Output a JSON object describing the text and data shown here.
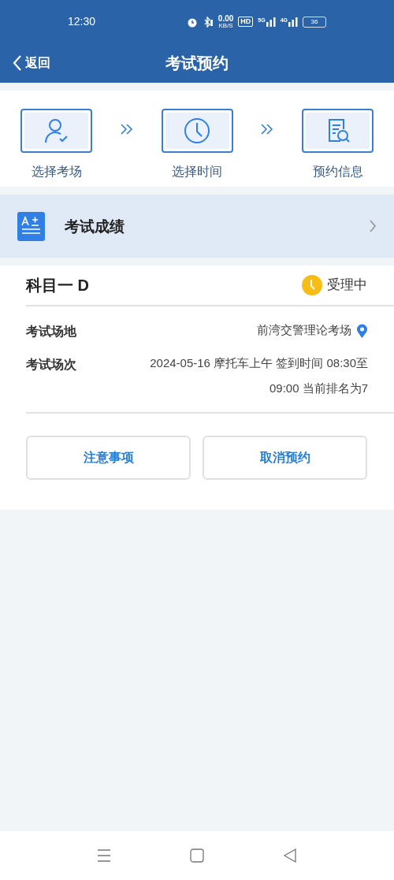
{
  "status_bar": {
    "time": "12:30",
    "speed": "0.00",
    "speed_unit": "KB/S",
    "hd": "HD",
    "networks": [
      "5G",
      "4G"
    ],
    "battery": "36"
  },
  "header": {
    "back": "返回",
    "title": "考试预约"
  },
  "steps": [
    {
      "kind": "person",
      "label": "选择考场"
    },
    {
      "kind": "clock",
      "label": "选择时间"
    },
    {
      "kind": "document",
      "label": "预约信息"
    }
  ],
  "score_link": {
    "label": "考试成绩"
  },
  "appointment": {
    "subject": "科目一 D",
    "status": "受理中",
    "details": [
      {
        "kind": "venue",
        "label": "考试场地",
        "value": "前湾交警理论考场"
      },
      {
        "kind": "session",
        "label": "考试场次",
        "value": "2024-05-16 摩托车上午 签到时间 08:30至09:00 当前排名为7"
      }
    ],
    "buttons": [
      "注意事项",
      "取消预约"
    ]
  }
}
